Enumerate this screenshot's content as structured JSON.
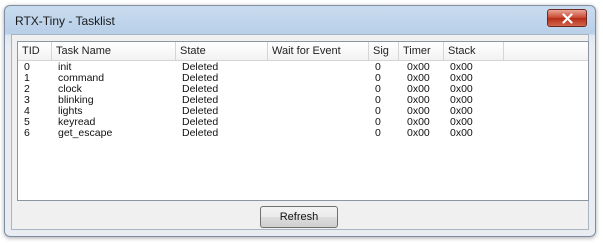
{
  "window": {
    "title": "RTX-Tiny - Tasklist"
  },
  "columns": [
    "TID",
    "Task Name",
    "State",
    "Wait for Event",
    "Sig",
    "Timer",
    "Stack"
  ],
  "rows": [
    [
      "0",
      "init",
      "Deleted",
      "",
      "0",
      "0x00",
      "0x00"
    ],
    [
      "1",
      "command",
      "Deleted",
      "",
      "0",
      "0x00",
      "0x00"
    ],
    [
      "2",
      "clock",
      "Deleted",
      "",
      "0",
      "0x00",
      "0x00"
    ],
    [
      "3",
      "blinking",
      "Deleted",
      "",
      "0",
      "0x00",
      "0x00"
    ],
    [
      "4",
      "lights",
      "Deleted",
      "",
      "0",
      "0x00",
      "0x00"
    ],
    [
      "5",
      "keyread",
      "Deleted",
      "",
      "0",
      "0x00",
      "0x00"
    ],
    [
      "6",
      "get_escape",
      "Deleted",
      "",
      "0",
      "0x00",
      "0x00"
    ]
  ],
  "buttons": {
    "refresh": "Refresh"
  },
  "icons": {
    "close": "close-icon"
  }
}
